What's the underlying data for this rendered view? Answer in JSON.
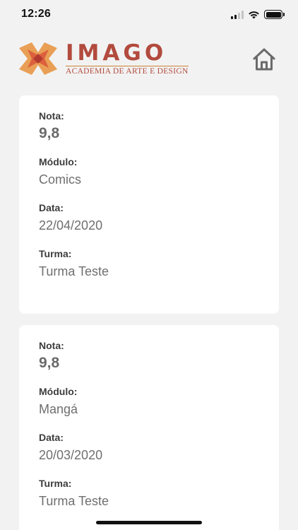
{
  "status_bar": {
    "time": "12:26"
  },
  "header": {
    "logo_title": "IMAGO",
    "logo_subtitle": "ACADEMIA DE ARTE E DESIGN",
    "brand_color": "#b24b3e",
    "accent_color": "#e8913a",
    "home_icon": "home-icon"
  },
  "grades": [
    {
      "nota_label": "Nota:",
      "nota": "9,8",
      "modulo_label": "Módulo:",
      "modulo": "Comics",
      "data_label": "Data:",
      "data": "22/04/2020",
      "turma_label": "Turma:",
      "turma": "Turma Teste"
    },
    {
      "nota_label": "Nota:",
      "nota": "9,8",
      "modulo_label": "Módulo:",
      "modulo": "Mangá",
      "data_label": "Data:",
      "data": "20/03/2020",
      "turma_label": "Turma:",
      "turma": "Turma Teste"
    }
  ]
}
